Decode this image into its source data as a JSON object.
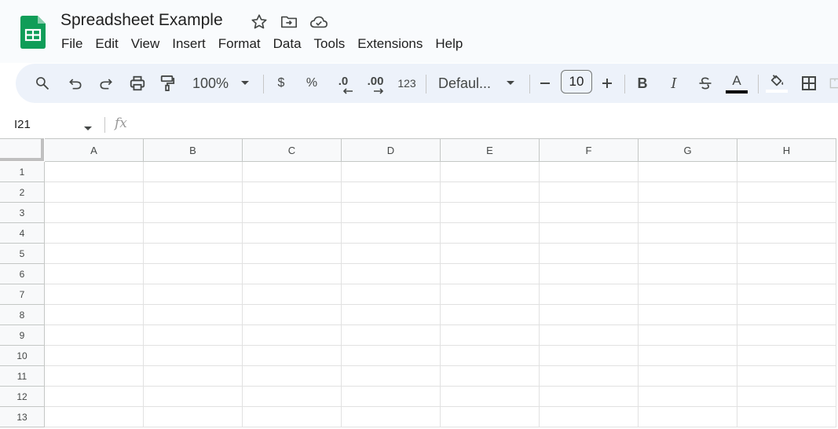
{
  "app": {
    "doc_title": "Spreadsheet Example",
    "title_icons": [
      "star-icon",
      "move-to-folder-icon",
      "cloud-saved-icon"
    ],
    "brand_color": "#0f9d58"
  },
  "menu": {
    "items": [
      "File",
      "Edit",
      "View",
      "Insert",
      "Format",
      "Data",
      "Tools",
      "Extensions",
      "Help"
    ]
  },
  "toolbar": {
    "zoom": "100%",
    "currency_label": "$",
    "percent_label": "%",
    "decrease_decimal_label": ".0",
    "increase_decimal_label": ".00",
    "number_format_label": "123",
    "font_name": "Defaul...",
    "font_size": "10",
    "bold_label": "B",
    "italic_label": "I",
    "text_color_label": "A",
    "icons": [
      "search-icon",
      "undo-icon",
      "redo-icon",
      "print-icon",
      "paint-format-icon",
      "chevron-down-icon",
      "minus-icon",
      "plus-icon",
      "strikethrough-icon",
      "text-color-icon",
      "fill-color-icon",
      "borders-icon",
      "merge-cells-icon"
    ]
  },
  "formula_bar": {
    "cell_ref": "I21",
    "fx_label": "fx",
    "value": ""
  },
  "sheet": {
    "columns": [
      "A",
      "B",
      "C",
      "D",
      "E",
      "F",
      "G",
      "H"
    ],
    "rows": [
      "1",
      "2",
      "3",
      "4",
      "5",
      "6",
      "7",
      "8",
      "9",
      "10",
      "11",
      "12",
      "13"
    ]
  }
}
